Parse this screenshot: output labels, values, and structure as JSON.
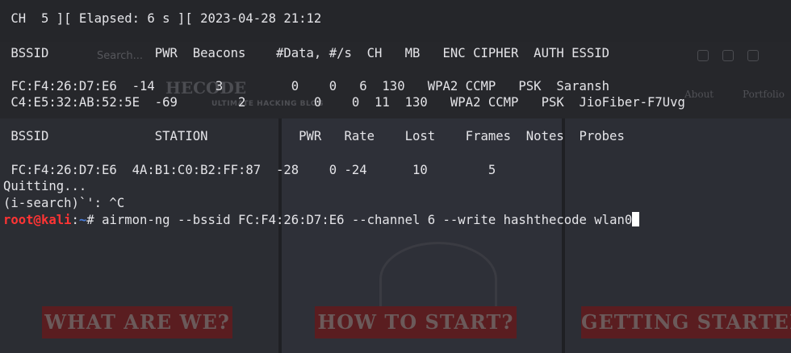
{
  "terminal": {
    "status_line": " CH  5 ][ Elapsed: 6 s ][ 2023-04-28 21:12",
    "ap_header": " BSSID              PWR  Beacons    #Data, #/s  CH   MB   ENC CIPHER  AUTH ESSID",
    "ap_rows": [
      " FC:F4:26:D7:E6  -14        3         0    0   6  130   WPA2 CCMP   PSK  Saransh",
      " C4:E5:32:AB:52:5E  -69        2         0    0  11  130   WPA2 CCMP   PSK  JioFiber-F7Uvg"
    ],
    "station_header": " BSSID              STATION            PWR   Rate    Lost    Frames  Notes  Probes",
    "station_rows": [
      " FC:F4:26:D7:E6  4A:B1:C0:B2:FF:87  -28    0 -24      10        5"
    ],
    "quitting": "Quitting...",
    "isearch": "(i-search)`': ^C",
    "prompt": {
      "user_host": "root@kali",
      "sep": ":",
      "path": "~",
      "symbol": "# ",
      "command": "airmon-ng --bssid FC:F4:26:D7:E6 --channel 6 --write hashthecode wlan0"
    }
  },
  "background": {
    "search_text": "Search...",
    "logo_text": "HECODE",
    "tagline": "ULTIMATE HACKING BLOG",
    "nav_items": [
      "About",
      "Portfolio"
    ],
    "banners": [
      "WHAT ARE WE?",
      "HOW TO START?",
      "GETTING STARTED"
    ]
  },
  "colors": {
    "terminal_bg": "#1f2024",
    "text": "#e4e4e8",
    "prompt_user": "#ff3434",
    "prompt_path": "#4a7cd8",
    "banner": "#5a1d20"
  }
}
